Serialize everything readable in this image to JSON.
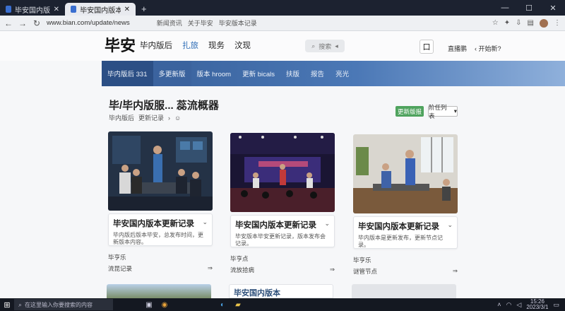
{
  "browser": {
    "tabs": [
      {
        "label": "毕安国内版本更新记录",
        "active": false
      },
      {
        "label": "毕安国内版本 update",
        "active": true
      }
    ],
    "new_tab": "+",
    "window_controls": [
      "—",
      "☐",
      "✕"
    ],
    "url": "www.bian.com/update/news",
    "bookmarks": [
      "新闻资讯",
      "关于毕安",
      "毕安版本记录"
    ],
    "nav": {
      "back": "←",
      "forward": "→",
      "reload": "↻"
    }
  },
  "site": {
    "logo": "毕安",
    "nav": [
      {
        "label": "毕内版后",
        "active": false
      },
      {
        "label": "扎旅",
        "active": true
      },
      {
        "label": "现务",
        "active": false
      },
      {
        "label": "汶现",
        "active": false
      }
    ],
    "search_label": "搜索",
    "header_button": "口",
    "header_link": "直播鹏",
    "header_link2": "开始新?"
  },
  "subnav": [
    {
      "label": "毕内版后 331",
      "style": "active"
    },
    {
      "label": "多更新版",
      "style": "second"
    },
    {
      "label": "版本 hroom",
      "style": ""
    },
    {
      "label": "更新 bicals",
      "style": ""
    },
    {
      "label": "扶版",
      "style": ""
    },
    {
      "label": "报告",
      "style": ""
    },
    {
      "label": "亮光",
      "style": ""
    }
  ],
  "page": {
    "title": "毕/毕内版服... 蕊流概器",
    "breadcrumb": [
      "毕内版后",
      "更新记录"
    ],
    "green_button": "更新版报",
    "select_button": "阶任列表"
  },
  "cards": [
    {
      "title": "毕安国内版本更新记录",
      "desc": "毕内版后版本毕安，总发布时间，更新版本内容。",
      "meta": "毕亨乐",
      "link": "流昆记录"
    },
    {
      "title": "毕安国内版本更新记录",
      "desc": "毕安版本毕安更新记录，版本发布会记录。",
      "meta": "毕亨点",
      "link": "流放拾病"
    },
    {
      "title": "毕安国内版本更新记录",
      "desc": "毕内版本是更新发布，更新节点记录。",
      "meta": "毕亨乐",
      "link": "谜管节点"
    }
  ],
  "second_row": [
    "",
    "毕安国内版本",
    ""
  ],
  "taskbar": {
    "search": "在这里输入你要搜索的内容",
    "time": "15:26",
    "date": "2023/3/1"
  },
  "colors": {
    "accent_blue": "#2d6cb6",
    "subnav_start": "#355d97",
    "green": "#4fa35e"
  }
}
